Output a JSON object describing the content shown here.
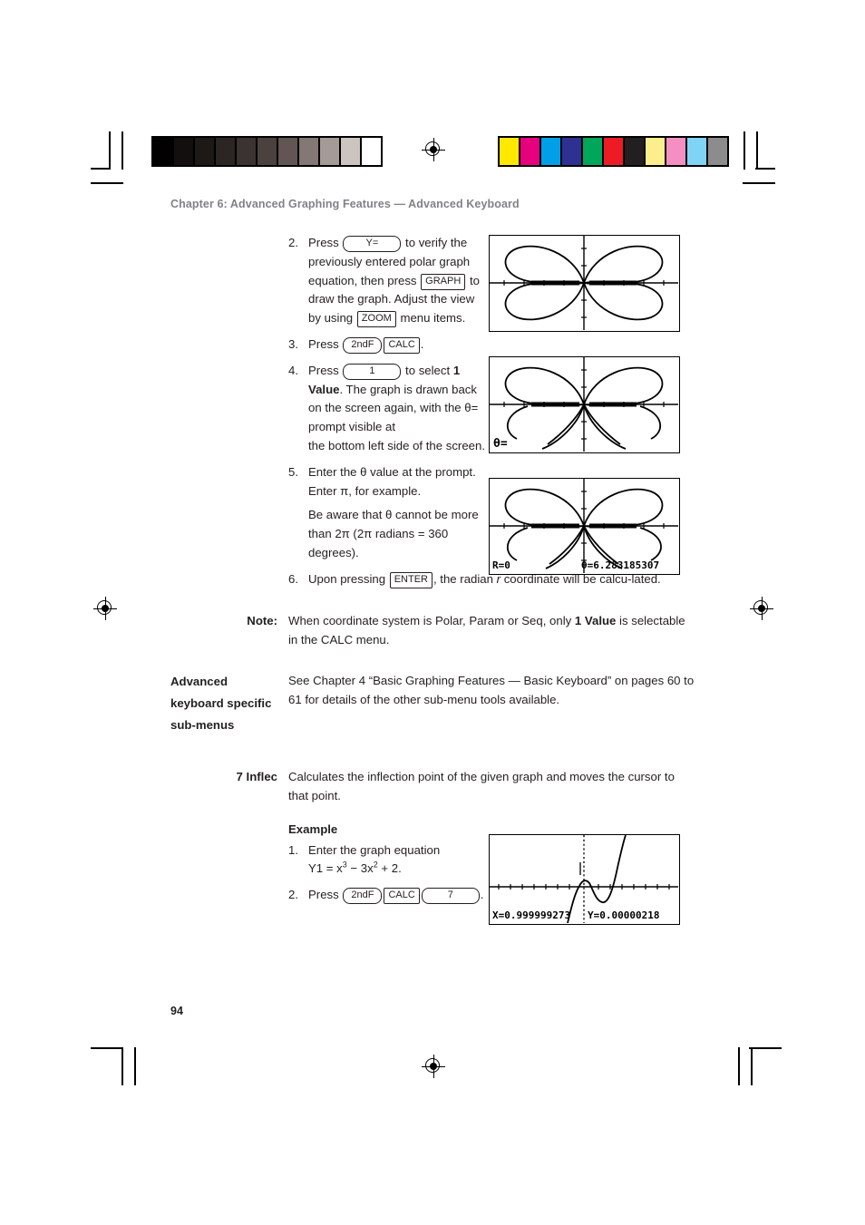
{
  "printer_marks": {
    "grayscale_swatches": [
      "#010101",
      "#120f0e",
      "#1d1917",
      "#2b2523",
      "#3b3331",
      "#4b423f",
      "#615653",
      "#837875",
      "#a49b98",
      "#cbc4c1",
      "#ffffff"
    ],
    "color_swatches": [
      "#ffe800",
      "#e6007e",
      "#00a0e9",
      "#2e3192",
      "#00a65a",
      "#ed1c24",
      "#231f20",
      "#fbee8c",
      "#f58fc2",
      "#7fd4f5",
      "#8c8c8c"
    ]
  },
  "header": {
    "chapter": "Chapter 6: Advanced Graphing Features — Advanced Keyboard"
  },
  "footer": {
    "page_number": "94"
  },
  "steps": [
    {
      "num": "2.",
      "parts": [
        {
          "t": "text",
          "v": "Press "
        },
        {
          "t": "key",
          "v": "Y="
        },
        {
          "t": "text",
          "v": " to verify the previously entered polar graph equation, then press "
        },
        {
          "t": "key",
          "v": "GRAPH"
        },
        {
          "t": "text",
          "v": " to draw the graph. Adjust the view by using "
        },
        {
          "t": "key",
          "v": "ZOOM"
        },
        {
          "t": "text",
          "v": " menu items."
        }
      ]
    },
    {
      "num": "3.",
      "parts": [
        {
          "t": "text",
          "v": "Press "
        },
        {
          "t": "key",
          "v": "2ndF"
        },
        {
          "t": "key",
          "v": "CALC"
        },
        {
          "t": "text",
          "v": "."
        }
      ]
    },
    {
      "num": "4.",
      "parts": [
        {
          "t": "text",
          "v": "Press "
        },
        {
          "t": "key",
          "v": "1"
        },
        {
          "t": "text",
          "v": " to select "
        },
        {
          "t": "bold",
          "v": "1 Value"
        },
        {
          "t": "text",
          "v": ". The graph is drawn back on the screen again, with the θ= prompt visible at the bottom left side of the screen."
        }
      ]
    },
    {
      "num": "5.",
      "parts": [
        {
          "t": "text",
          "v": "Enter the θ value at the prompt. Enter π, for example."
        }
      ],
      "para2": "Be aware that θ cannot be more than 2π (2π radians = 360 degrees)."
    },
    {
      "num": "6.",
      "parts": [
        {
          "t": "text",
          "v": "Upon pressing "
        },
        {
          "t": "key",
          "v": "ENTER"
        },
        {
          "t": "text",
          "v": ", the radian "
        },
        {
          "t": "italic",
          "v": "r"
        },
        {
          "t": "text",
          "v": " coordinate will be calculated."
        }
      ]
    }
  ],
  "note": {
    "label": "Note:",
    "text_before": "When coordinate system is Polar, Param or Seq, only ",
    "bold": "1 Value",
    "text_after": " is selectable in the CALC menu."
  },
  "advanced_section": {
    "label": "Advanced keyboard specific sub-menus",
    "text": "See Chapter 4 “Basic Graphing Features — Basic Keyboard” on pages 60 to 61 for details of the other sub-menu tools available."
  },
  "inflec_section": {
    "label": "7 Inflec",
    "text": "Calculates the inflection point of the given graph and moves the cursor to that point.",
    "example_heading": "Example",
    "example_steps": [
      {
        "num": "1.",
        "line1": "Enter the graph equation",
        "line2_prefix": "Y1 = x",
        "line2_sup1": "3",
        "line2_mid": " − 3x",
        "line2_sup2": "2",
        "line2_suffix": " + 2."
      },
      {
        "num": "2.",
        "prefix": "Press ",
        "keys": [
          "2ndF",
          "CALC",
          "7"
        ],
        "suffix": "."
      }
    ]
  },
  "calc_screens": [
    {
      "name": "polar-rose-plain",
      "curve": "4-petal polar rose",
      "bottom_left": "",
      "bottom_right": ""
    },
    {
      "name": "polar-rose-theta-prompt",
      "curve": "4-petal polar rose",
      "bottom_left": "θ=",
      "bottom_right": ""
    },
    {
      "name": "polar-rose-theta-value",
      "curve": "4-petal polar rose",
      "bottom_left": "R=0",
      "bottom_right": "θ=6.283185307"
    },
    {
      "name": "cubic-inflection",
      "curve": "cubic y = x^3 - 3x^2 + 2",
      "bottom_left": "X=0.999999273",
      "bottom_right": "Y=0.00000218"
    }
  ]
}
